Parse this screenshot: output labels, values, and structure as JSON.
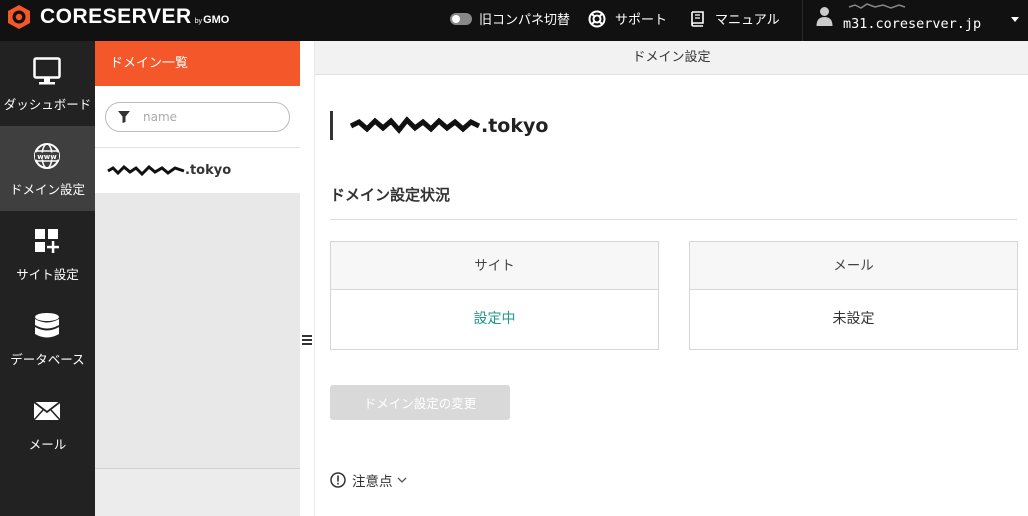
{
  "topbar": {
    "brand": "CORESERVER",
    "brand_by": "by",
    "brand_gmo": "GMO",
    "legacy_toggle_label": "旧コンパネ切替",
    "support_label": "サポート",
    "manual_label": "マニュアル",
    "host": "m31.coreserver.jp"
  },
  "nav": {
    "items": [
      {
        "label": "ダッシュボード",
        "icon": "monitor-icon"
      },
      {
        "label": "ドメイン設定",
        "icon": "www-globe-icon"
      },
      {
        "label": "サイト設定",
        "icon": "grid-plus-icon"
      },
      {
        "label": "データベース",
        "icon": "database-icon"
      },
      {
        "label": "メール",
        "icon": "envelope-icon"
      }
    ]
  },
  "domain_list": {
    "header": "ドメイン一覧",
    "search_placeholder": "name",
    "items": [
      {
        "suffix": ".tokyo"
      }
    ]
  },
  "main": {
    "header": "ドメイン設定",
    "domain_suffix": ".tokyo",
    "status_title": "ドメイン設定状況",
    "site": {
      "label": "サイト",
      "status": "設定中"
    },
    "mail": {
      "label": "メール",
      "status": "未設定"
    },
    "change_button": "ドメイン設定の変更",
    "notes_label": "注意点"
  },
  "colors": {
    "accent": "#f4572a",
    "status_ok": "#1d9a86",
    "nav_bg": "#222222",
    "topbar_bg": "#111111"
  }
}
